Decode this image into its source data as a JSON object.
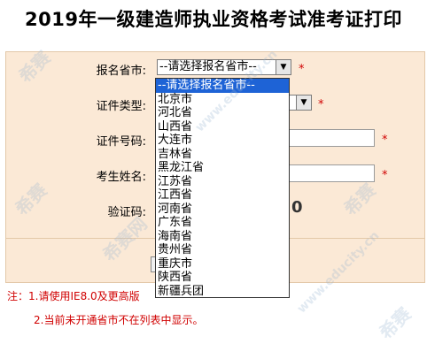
{
  "title": "2019年一级建造师执业资格考试准考证打印",
  "form": {
    "province_label": "报名省市:",
    "province_selected": "--请选择报名省市--",
    "id_type_label": "证件类型:",
    "id_number_label": "证件号码:",
    "name_label": "考生姓名:",
    "captcha_label": "验证码:",
    "captcha_partial": "0",
    "required_mark": "*"
  },
  "dropdown": {
    "options": [
      "--请选择报名省市--",
      "北京市",
      "河北省",
      "山西省",
      "大连市",
      "吉林省",
      "黑龙江省",
      "江苏省",
      "江西省",
      "河南省",
      "广东省",
      "海南省",
      "贵州省",
      "重庆市",
      "陕西省",
      "新疆兵团"
    ]
  },
  "notes": {
    "line1": "注：1.请使用IE8.0及更高版",
    "line2": "2.当前未开通省市不在列表中显示。"
  },
  "watermarks": [
    "希赛",
    "www.educity.cn",
    "希赛网"
  ]
}
